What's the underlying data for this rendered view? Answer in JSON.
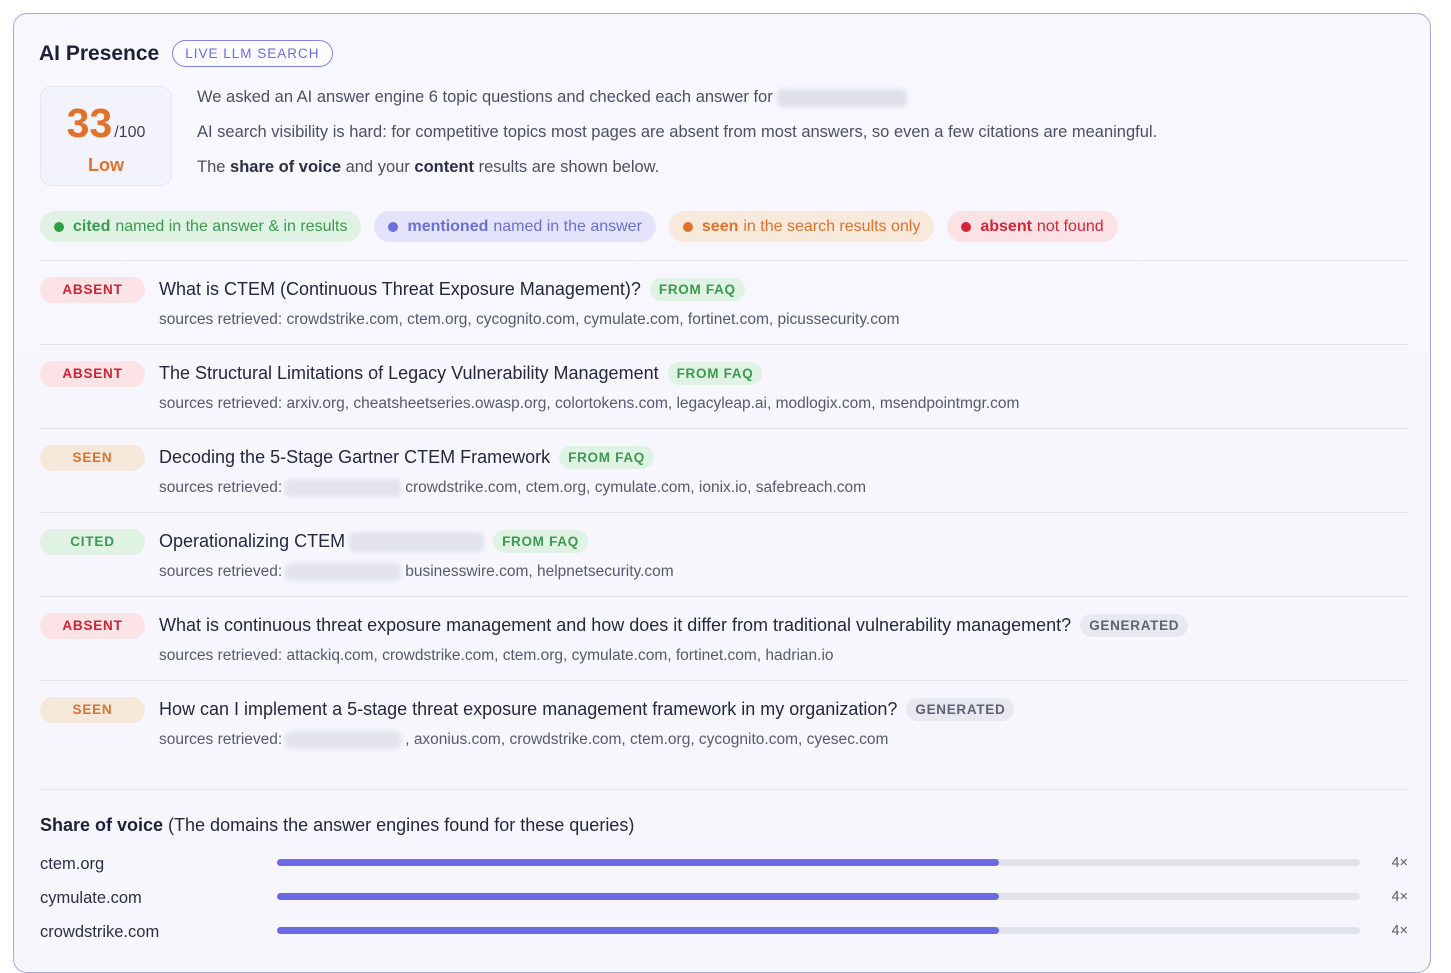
{
  "header": {
    "title": "AI Presence",
    "badge": "LIVE LLM SEARCH"
  },
  "score": {
    "value": "33",
    "max": "/100",
    "level": "Low"
  },
  "intro": {
    "line1": "We asked an AI answer engine 6 topic questions and checked each answer for",
    "line2": "AI search visibility is hard: for competitive topics most pages are absent from most answers, so even a few citations are meaningful.",
    "line3_pre": "The ",
    "line3_b1": "share of voice",
    "line3_mid": " and your ",
    "line3_b2": "content",
    "line3_post": " results are shown below."
  },
  "legend": [
    {
      "key": "cited",
      "desc": "named in the answer & in results"
    },
    {
      "key": "mentioned",
      "desc": "named in the answer"
    },
    {
      "key": "seen",
      "desc": "in the search results only"
    },
    {
      "key": "absent",
      "desc": "not found"
    }
  ],
  "sources_label": "sources retrieved:",
  "questions": [
    {
      "status": "ABSENT",
      "text": "What is CTEM (Continuous Threat Exposure Management)?",
      "tag": "FROM FAQ",
      "sources": "crowdstrike.com, ctem.org, cycognito.com, cymulate.com, fortinet.com, picussecurity.com"
    },
    {
      "status": "ABSENT",
      "text": "The Structural Limitations of Legacy Vulnerability Management",
      "tag": "FROM FAQ",
      "sources": "arxiv.org, cheatsheetseries.owasp.org, colortokens.com, legacyleap.ai, modlogix.com, msendpointmgr.com"
    },
    {
      "status": "SEEN",
      "text": "Decoding the 5-Stage Gartner CTEM Framework",
      "tag": "FROM FAQ",
      "sources": "crowdstrike.com, ctem.org, cymulate.com, ionix.io, safebreach.com"
    },
    {
      "status": "CITED",
      "text": "Operationalizing CTEM",
      "tag": "FROM FAQ",
      "sources": "businesswire.com, helpnetsecurity.com"
    },
    {
      "status": "ABSENT",
      "text": "What is continuous threat exposure management and how does it differ from traditional vulnerability management?",
      "tag": "GENERATED",
      "sources": "attackiq.com, crowdstrike.com, ctem.org, cymulate.com, fortinet.com, hadrian.io"
    },
    {
      "status": "SEEN",
      "text": "How can I implement a 5-stage threat exposure management framework in my organization?",
      "tag": "GENERATED",
      "sources": ", axonius.com, crowdstrike.com, ctem.org, cycognito.com, cyesec.com"
    }
  ],
  "share_of_voice": {
    "title": "Share of voice",
    "subtitle": " (The domains the answer engines found for these queries)",
    "items": [
      {
        "domain": "ctem.org",
        "count": "4×",
        "fraction": 0.667
      },
      {
        "domain": "cymulate.com",
        "count": "4×",
        "fraction": 0.667
      },
      {
        "domain": "crowdstrike.com",
        "count": "4×",
        "fraction": 0.667
      }
    ]
  }
}
